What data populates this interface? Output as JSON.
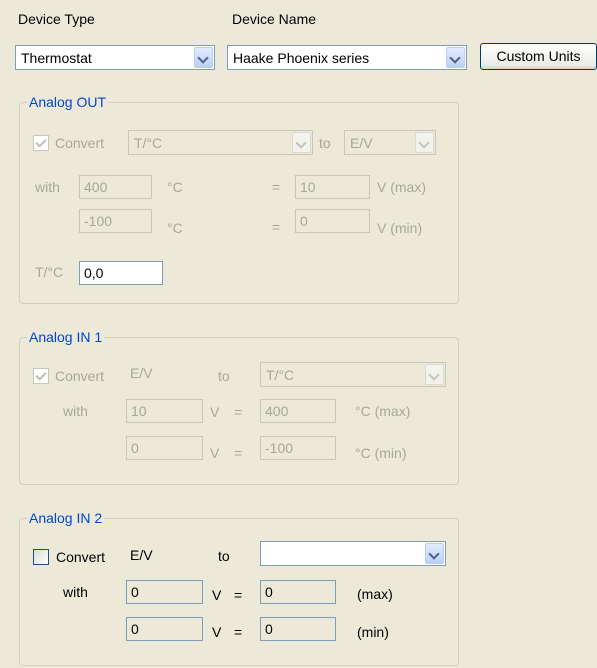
{
  "header": {
    "device_type_label": "Device Type",
    "device_type_value": "Thermostat",
    "device_name_label": "Device Name",
    "device_name_value": "Haake Phoenix series",
    "custom_units_label": "Custom Units"
  },
  "analog_out": {
    "title": "Analog OUT",
    "convert_label": "Convert",
    "from_unit": "T/°C",
    "to_label": "to",
    "to_unit": "E/V",
    "with_label": "with",
    "max_in": "400",
    "max_in_unit": "°C",
    "eq": "=",
    "max_out": "10",
    "max_out_unit": "V (max)",
    "min_in": "-100",
    "min_in_unit": "°C",
    "min_out": "0",
    "min_out_unit": "V (min)",
    "t_label": "T/°C",
    "t_value": "0,0"
  },
  "analog_in1": {
    "title": "Analog IN 1",
    "convert_label": "Convert",
    "from_unit": "E/V",
    "to_label": "to",
    "to_unit": "T/°C",
    "with_label": "with",
    "max_in": "10",
    "in_unit": "V",
    "eq": "=",
    "max_out": "400",
    "max_out_unit": "°C (max)",
    "min_in": "0",
    "min_out": "-100",
    "min_out_unit": "°C (min)"
  },
  "analog_in2": {
    "title": "Analog IN 2",
    "convert_label": "Convert",
    "from_unit": "E/V",
    "to_label": "to",
    "to_unit": "",
    "with_label": "with",
    "max_in": "0",
    "in_unit": "V",
    "eq": "=",
    "max_out": "0",
    "max_out_unit": "(max)",
    "min_in": "0",
    "min_out": "0",
    "min_out_unit": "(min)"
  }
}
